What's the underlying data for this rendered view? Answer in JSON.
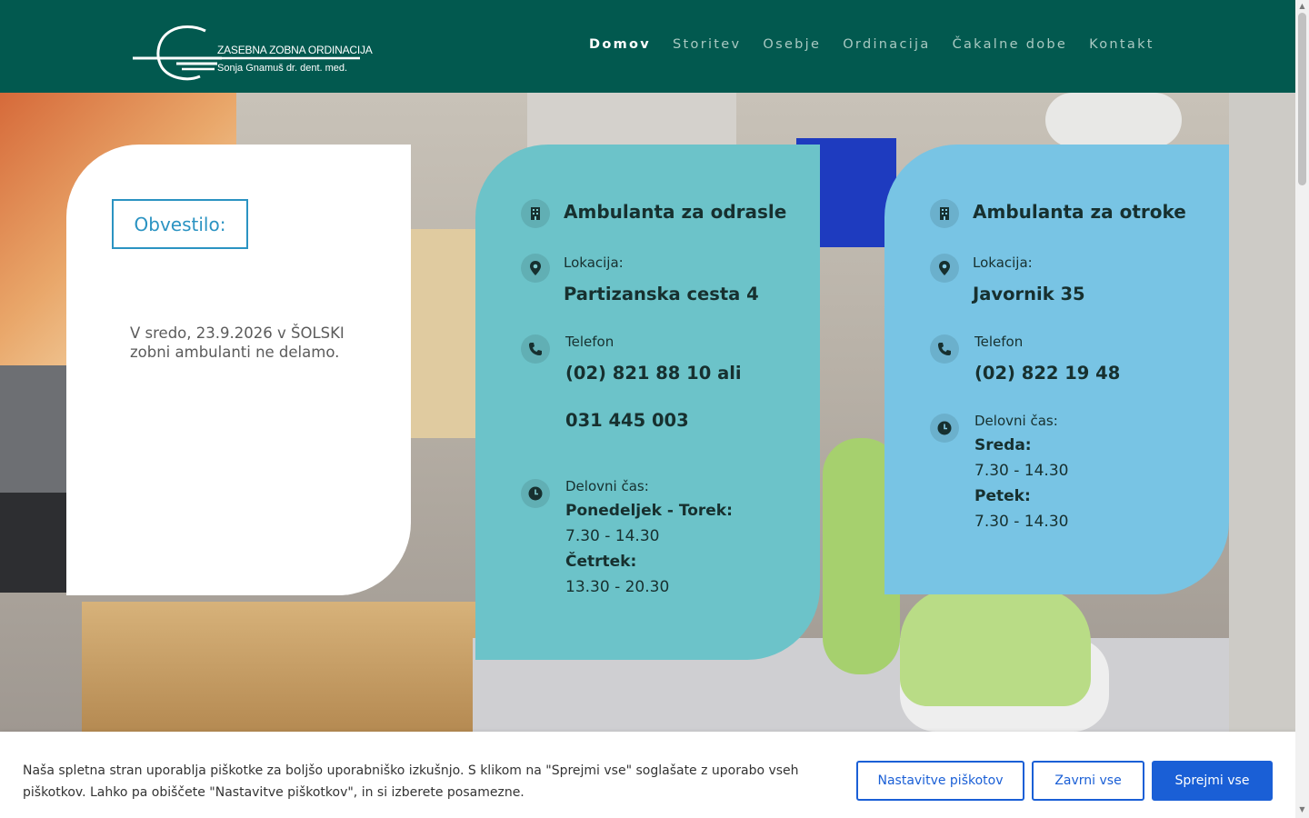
{
  "header": {
    "logo": {
      "line1": "ZASEBNA ZOBNA ORDINACIJA",
      "line2": "Sonja Gnamuš dr. dent. med.",
      "mark_icon": "logo-g-mark"
    },
    "nav": [
      {
        "label": "Domov",
        "active": true
      },
      {
        "label": "Storitev",
        "active": false
      },
      {
        "label": "Osebje",
        "active": false
      },
      {
        "label": "Ordinacija",
        "active": false
      },
      {
        "label": "Čakalne dobe",
        "active": false
      },
      {
        "label": "Kontakt",
        "active": false
      }
    ]
  },
  "notice": {
    "title": "Obvestilo:",
    "text": "V sredo, 23.9.2026 v ŠOLSKI zobni ambulanti ne delamo."
  },
  "adults": {
    "title": "Ambulanta za odrasle",
    "location_label": "Lokacija:",
    "location_value": "Partizanska cesta 4",
    "phone_label": "Telefon",
    "phone_value1": "(02) 821 88 10 ali",
    "phone_value2": "031 445 003",
    "hours_label": "Delovni čas:",
    "day1": "Ponedeljek - Torek:",
    "hours1": "7.30 - 14.30",
    "day2": "Četrtek:",
    "hours2": "13.30 - 20.30"
  },
  "kids": {
    "title": "Ambulanta za otroke",
    "location_label": "Lokacija:",
    "location_value": "Javornik 35",
    "phone_label": "Telefon",
    "phone_value": "(02) 822 19 48",
    "hours_label": "Delovni čas:",
    "day1": "Sreda:",
    "hours1": "7.30 - 14.30",
    "day2": "Petek:",
    "hours2": "7.30 - 14.30"
  },
  "icons": {
    "building": "building-icon",
    "location": "map-pin-icon",
    "phone": "phone-icon",
    "clock": "clock-icon"
  },
  "cookie": {
    "text": "Naša spletna stran uporablja piškotke za boljšo uporabniško izkušnjo. S klikom na \"Sprejmi vse\" soglašate z uporabo vseh piškotkov. Lahko pa obiščete \"Nastavitve piškotkov\", in si izberete posamezne.",
    "settings_label": "Nastavitve piškotov",
    "reject_label": "Zavrni vse",
    "accept_label": "Sprejmi vse"
  },
  "colors": {
    "header_bg": "#02594f",
    "adults_card": "#6cc3c9",
    "kids_card": "#78c4e4",
    "notice_accent": "#2b93c2",
    "button_blue": "#1a5fd6"
  }
}
